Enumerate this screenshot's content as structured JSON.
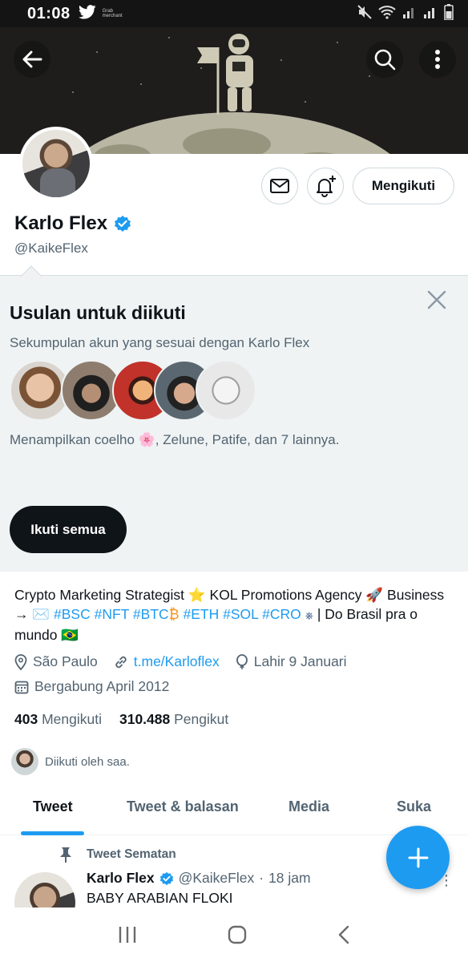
{
  "status_bar": {
    "time": "01:08",
    "tiny_label": "Grab\nmerchant",
    "icons": [
      "twitter-icon",
      "mute-icon",
      "wifi-icon",
      "signal-icon",
      "signal-icon",
      "battery-icon"
    ]
  },
  "header": {
    "back_icon": "arrow-left-icon",
    "search_icon": "search-icon",
    "more_icon": "more-vertical-icon"
  },
  "profile": {
    "name": "Karlo Flex",
    "handle": "@KaikeFlex",
    "verified": true,
    "following_button_label": "Mengikuti",
    "message_icon": "mail-icon",
    "notify_icon": "bell-plus-icon"
  },
  "suggestions": {
    "title": "Usulan untuk diikuti",
    "subtitle": "Sekumpulan akun yang sesuai dengan Karlo Flex",
    "showing_text": "Menampilkan coelho 🌸, Zelune, Patife, dan 7 lainnya.",
    "follow_all_label": "Ikuti semua",
    "close_icon": "close-icon"
  },
  "bio": {
    "line1": "Crypto Marketing Strategist ⭐ KOL Promotions Agency 🚀 Business",
    "arrow": "→ ✉️ ",
    "hashtags": [
      "#BSC",
      "#NFT",
      "#BTC",
      "#ETH",
      "#SOL",
      "#CRO"
    ],
    "btc_icon": "₿",
    "cro_icon": "⎈",
    "tail": "| Do Brasil pra o",
    "line3": "mundo 🇧🇷"
  },
  "meta": {
    "location": "São Paulo",
    "link": "t.me/Karloflex",
    "birthday": "Lahir 9 Januari",
    "joined": "Bergabung April 2012"
  },
  "counts": {
    "following_number": "403",
    "following_label": "Mengikuti",
    "followers_number": "310.488",
    "followers_label": "Pengikut"
  },
  "followed_by": "Diikuti oleh saa.",
  "tabs": [
    {
      "label": "Tweet",
      "active": true
    },
    {
      "label": "Tweet & balasan",
      "active": false
    },
    {
      "label": "Media",
      "active": false
    },
    {
      "label": "Suka",
      "active": false
    }
  ],
  "pinned": {
    "label": "Tweet Sematan",
    "author_name": "Karlo Flex",
    "author_handle": "@KaikeFlex",
    "separator": "·",
    "time": "18 jam",
    "text": "BABY ARABIAN FLOKI"
  },
  "fab_icon": "plus-icon",
  "colors": {
    "accent": "#1d9bf0",
    "text": "#0f1419",
    "muted": "#536471",
    "panel": "#eff3f4",
    "dark_button": "#0f1419"
  }
}
